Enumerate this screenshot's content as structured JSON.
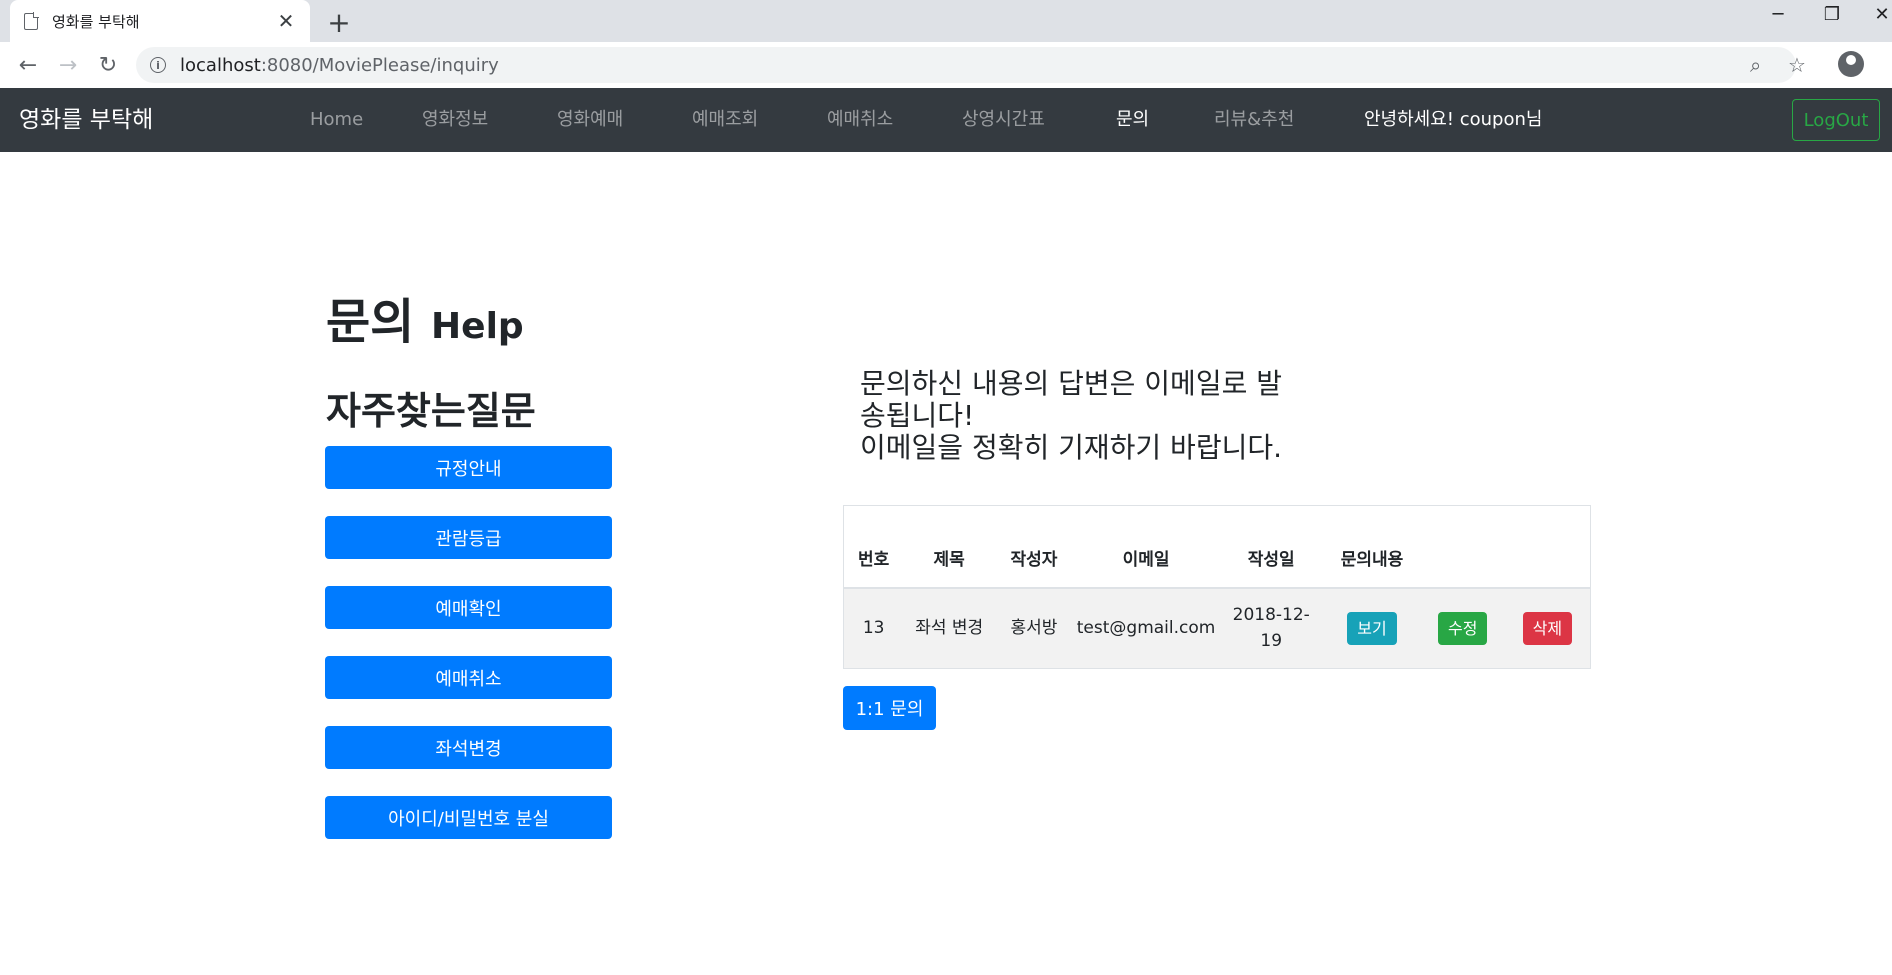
{
  "browser": {
    "tab_title": "영화를 부탁해",
    "url_host": "localhost",
    "url_rest": ":8080/MoviePlease/inquiry"
  },
  "navbar": {
    "brand": "영화를 부탁해",
    "links": [
      "Home",
      "영화정보",
      "영화예매",
      "예매조회",
      "예매취소",
      "상영시간표",
      "문의",
      "리뷰&추천"
    ],
    "active_link": "문의",
    "greeting": "안녕하세요! coupon님",
    "logout_label": "LogOut"
  },
  "page": {
    "title": "문의",
    "title_sub": "Help"
  },
  "faq": {
    "title": "자주찾는질문",
    "items": [
      "규정안내",
      "관람등급",
      "예매확인",
      "예매취소",
      "좌석변경",
      "아이디/비밀번호 분실"
    ]
  },
  "notice": {
    "line1": "문의하신 내용의 답변은 이메일로 발송됩니다!",
    "line2": "이메일을 정확히 기재하기 바랍니다."
  },
  "table": {
    "headers": [
      "번호",
      "제목",
      "작성자",
      "이메일",
      "작성일",
      "문의내용"
    ],
    "rows": [
      {
        "no": "13",
        "subject": "좌석 변경",
        "author": "홍서방",
        "email": "test@gmail.com",
        "date": "2018-12-19",
        "view_label": "보기",
        "edit_label": "수정",
        "delete_label": "삭제"
      }
    ]
  },
  "inquiry_button": "1:1 문의",
  "colors": {
    "primary": "#007bff",
    "info": "#17a2b8",
    "success": "#28a745",
    "danger": "#dc3545",
    "navbar_bg": "#343a40"
  }
}
